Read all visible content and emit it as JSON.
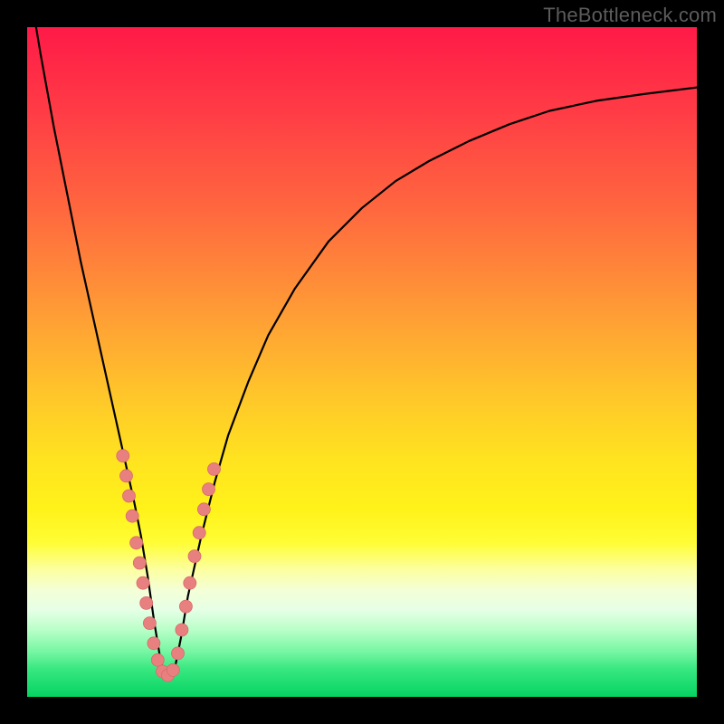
{
  "watermark": "TheBottleneck.com",
  "colors": {
    "frame": "#000000",
    "curve": "#000000",
    "dots": "#e88080"
  },
  "chart_data": {
    "type": "line",
    "title": "",
    "xlabel": "",
    "ylabel": "",
    "xlim": [
      0,
      100
    ],
    "ylim": [
      0,
      100
    ],
    "series": [
      {
        "name": "bottleneck-curve",
        "x": [
          0,
          2,
          4,
          6,
          8,
          10,
          12,
          14,
          16,
          17,
          18,
          19,
          20,
          21,
          22,
          23,
          24,
          26,
          28,
          30,
          33,
          36,
          40,
          45,
          50,
          55,
          60,
          66,
          72,
          78,
          85,
          92,
          100
        ],
        "y": [
          108,
          96,
          85,
          75,
          65,
          56,
          47,
          38,
          29,
          24,
          18,
          11,
          5,
          3,
          4,
          9,
          15,
          24,
          32,
          39,
          47,
          54,
          61,
          68,
          73,
          77,
          80,
          83,
          85.5,
          87.5,
          89,
          90,
          91
        ]
      }
    ],
    "highlight_dots": {
      "name": "sample-points",
      "points": [
        {
          "x": 14.3,
          "y": 36
        },
        {
          "x": 14.8,
          "y": 33
        },
        {
          "x": 15.2,
          "y": 30
        },
        {
          "x": 15.7,
          "y": 27
        },
        {
          "x": 16.3,
          "y": 23
        },
        {
          "x": 16.8,
          "y": 20
        },
        {
          "x": 17.3,
          "y": 17
        },
        {
          "x": 17.8,
          "y": 14
        },
        {
          "x": 18.3,
          "y": 11
        },
        {
          "x": 18.9,
          "y": 8
        },
        {
          "x": 19.5,
          "y": 5.5
        },
        {
          "x": 20.2,
          "y": 3.8
        },
        {
          "x": 21.0,
          "y": 3.2
        },
        {
          "x": 21.8,
          "y": 4.0
        },
        {
          "x": 22.5,
          "y": 6.5
        },
        {
          "x": 23.1,
          "y": 10
        },
        {
          "x": 23.7,
          "y": 13.5
        },
        {
          "x": 24.3,
          "y": 17
        },
        {
          "x": 25.0,
          "y": 21
        },
        {
          "x": 25.7,
          "y": 24.5
        },
        {
          "x": 26.4,
          "y": 28
        },
        {
          "x": 27.1,
          "y": 31
        },
        {
          "x": 27.9,
          "y": 34
        }
      ]
    },
    "background_gradient_stops": [
      {
        "pos": 0,
        "color": "#ff1a47"
      },
      {
        "pos": 50,
        "color": "#ffc62a"
      },
      {
        "pos": 78,
        "color": "#fffe60"
      },
      {
        "pos": 100,
        "color": "#06d362"
      }
    ]
  }
}
